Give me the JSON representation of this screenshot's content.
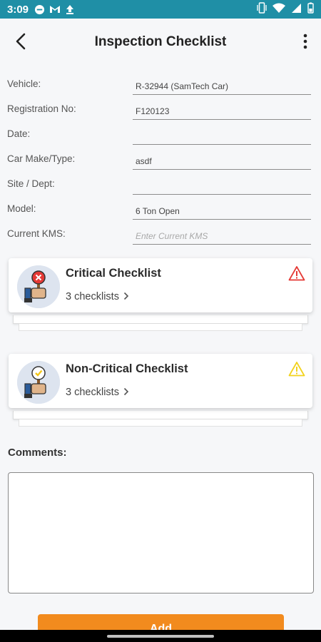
{
  "status": {
    "time": "3:09"
  },
  "header": {
    "title": "Inspection Checklist"
  },
  "form": {
    "fields": [
      {
        "label": "Vehicle:",
        "value": "R-32944 (SamTech Car)"
      },
      {
        "label": "Registration No:",
        "value": "F120123"
      },
      {
        "label": "Date:",
        "value": ""
      },
      {
        "label": "Car Make/Type:",
        "value": "asdf"
      },
      {
        "label": "Site / Dept:",
        "value": ""
      },
      {
        "label": "Model:",
        "value": "6 Ton Open"
      },
      {
        "label": "Current KMS:",
        "placeholder": "Enter Current KMS"
      }
    ]
  },
  "cards": {
    "critical": {
      "title": "Critical Checklist",
      "subtitle": "3 checklists",
      "accent": "#e53935",
      "warn_color": "#e53935"
    },
    "noncritical": {
      "title": "Non-Critical Checklist",
      "subtitle": "3 checklists",
      "accent": "#f2c618",
      "warn_color": "#f2d21c"
    }
  },
  "comments": {
    "label": "Comments:",
    "value": ""
  },
  "actions": {
    "add_label": "Add"
  }
}
